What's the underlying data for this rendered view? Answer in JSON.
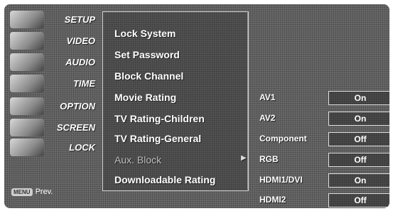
{
  "sidebar": {
    "items": [
      {
        "label": "SETUP"
      },
      {
        "label": "VIDEO"
      },
      {
        "label": "AUDIO"
      },
      {
        "label": "TIME"
      },
      {
        "label": "OPTION"
      },
      {
        "label": "SCREEN"
      },
      {
        "label": "LOCK"
      }
    ],
    "menu_key": "MENU",
    "prev_label": "Prev."
  },
  "submenu": {
    "items": [
      {
        "label": "Lock System"
      },
      {
        "label": "Set Password"
      },
      {
        "label": "Block Channel"
      },
      {
        "label": "Movie Rating"
      },
      {
        "label": "TV Rating-Children"
      },
      {
        "label": "TV Rating-General"
      },
      {
        "label": "Aux. Block"
      },
      {
        "label": "Downloadable Rating"
      }
    ],
    "arrow": "▶"
  },
  "options": {
    "rows": [
      {
        "label": "AV1",
        "value": "On"
      },
      {
        "label": "AV2",
        "value": "On"
      },
      {
        "label": "Component",
        "value": "Off"
      },
      {
        "label": "RGB",
        "value": "Off"
      },
      {
        "label": "HDMI1/DVI",
        "value": "On"
      },
      {
        "label": "HDMI2",
        "value": "Off"
      }
    ]
  }
}
